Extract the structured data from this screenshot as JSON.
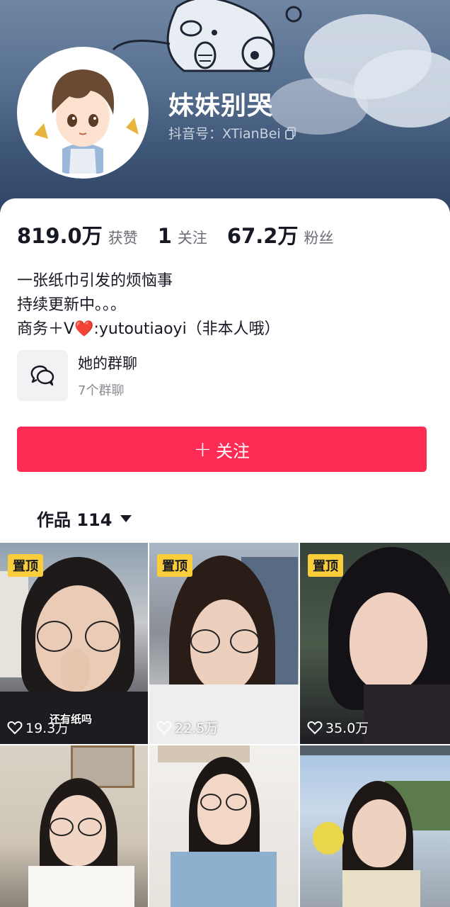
{
  "profile": {
    "nickname": "妹妹别哭",
    "douyin_id": "抖音号：XTianBei"
  },
  "stats": [
    {
      "value": "819.0万",
      "label": "获赞"
    },
    {
      "value": "1",
      "label": "关注"
    },
    {
      "value": "67.2万",
      "label": "粉丝"
    }
  ],
  "bio": {
    "line1": "一张纸巾引发的烦恼事",
    "line2": "持续更新中。。。",
    "line3_prefix": "商务＋V",
    "line3_heart": "❤️",
    "line3_suffix": ":yutoutiaoyi（非本人哦）"
  },
  "group_chat": {
    "title": "她的群聊",
    "subtitle": "7个群聊"
  },
  "follow_button": {
    "plus": "+",
    "label": "关注"
  },
  "works_tab": {
    "label": "作品 114"
  },
  "videos": [
    {
      "pinned_label": "置顶",
      "likes": "19.3万",
      "caption": "还有纸吗"
    },
    {
      "pinned_label": "置顶",
      "likes": "22.5万"
    },
    {
      "pinned_label": "置顶",
      "likes": "35.0万"
    },
    {},
    {},
    {}
  ],
  "colors": {
    "accent": "#fe2c55",
    "pin_badge": "#facd3b"
  }
}
